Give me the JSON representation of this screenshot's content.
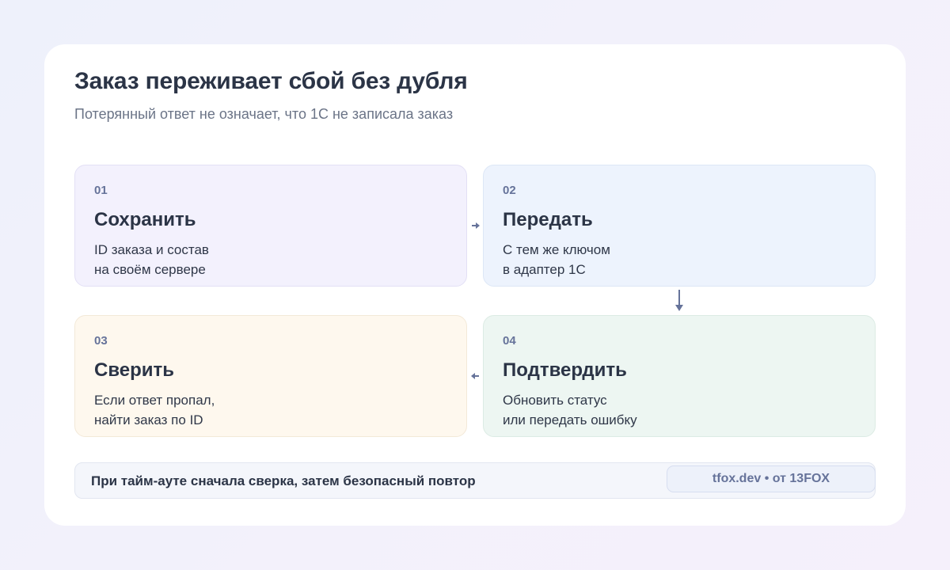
{
  "header": {
    "title": "Заказ переживает сбой без дубля",
    "subtitle": "Потерянный ответ не означает, что 1С не записала заказ"
  },
  "steps": [
    {
      "number": "01",
      "title": "Сохранить",
      "desc_line1": "ID заказа и состав",
      "desc_line2": "на своём сервере",
      "color": "#f3f1fd"
    },
    {
      "number": "02",
      "title": "Передать",
      "desc_line1": "С тем же ключом",
      "desc_line2": "в адаптер 1С",
      "color": "#edf3fd"
    },
    {
      "number": "03",
      "title": "Сверить",
      "desc_line1": "Если ответ пропал,",
      "desc_line2": "найти заказ по ID",
      "color": "#fef8ee"
    },
    {
      "number": "04",
      "title": "Подтвердить",
      "desc_line1": "Обновить статус",
      "desc_line2": "или передать ошибку",
      "color": "#edf6f2"
    }
  ],
  "footer": {
    "note": "При тайм-ауте сначала сверка, затем безопасный повтор",
    "badge": "tfox.dev • от 13FOX"
  },
  "colors": {
    "arrow": "#66739a",
    "title": "#2b3446"
  },
  "icons": {
    "arrow_1_2": "arrow-right-icon",
    "arrow_2_4": "arrow-down-icon",
    "arrow_4_3": "arrow-left-icon"
  }
}
